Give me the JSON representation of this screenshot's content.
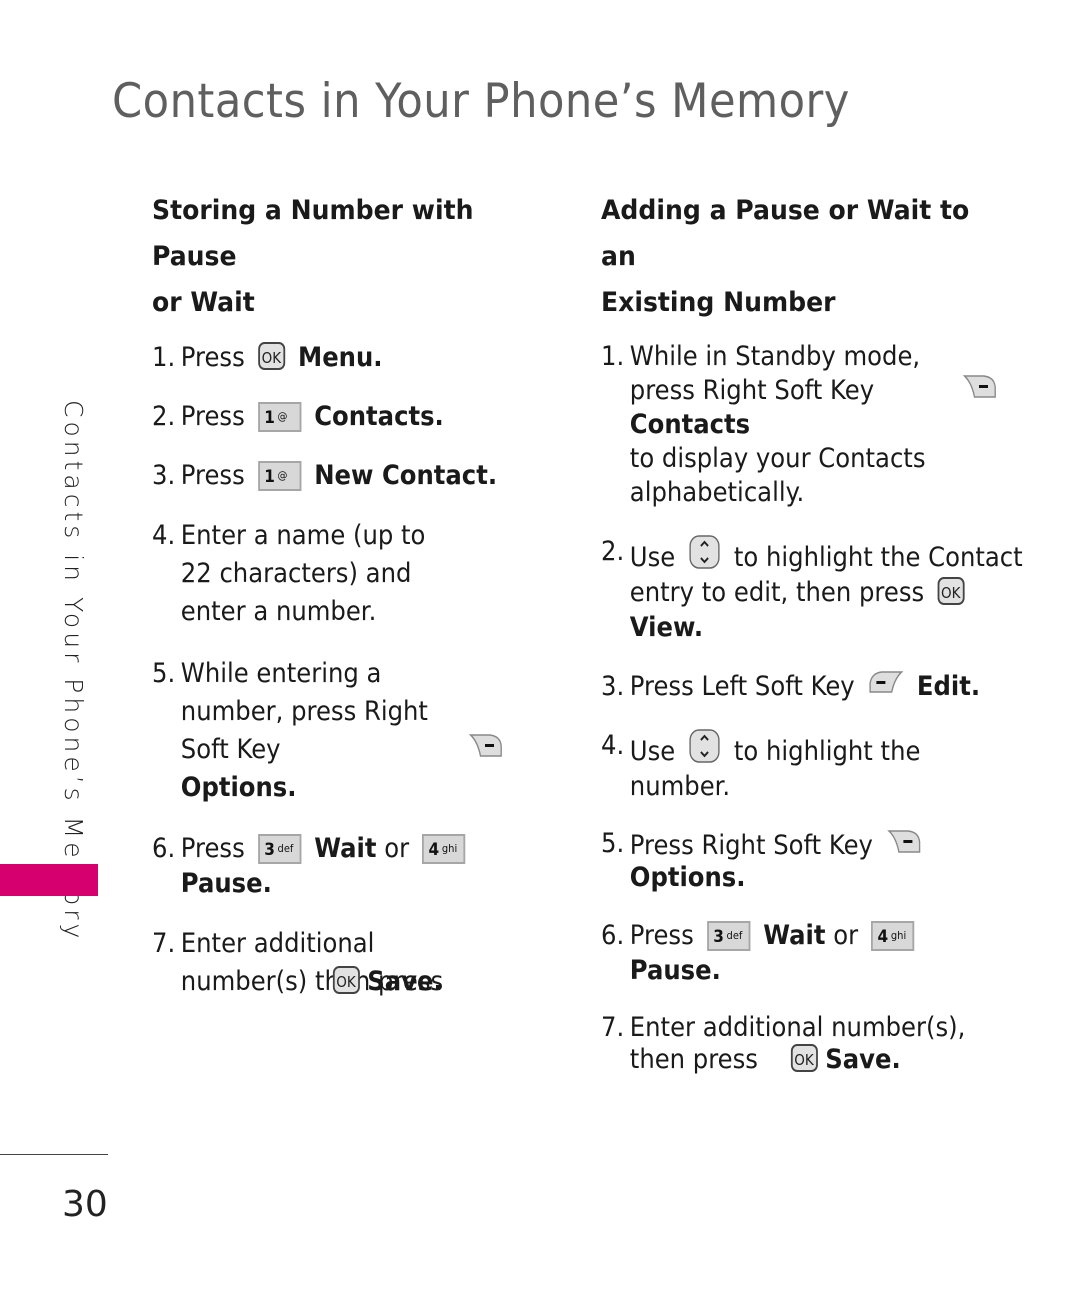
{
  "page": {
    "title": "Contacts in Your Phone’s Memory",
    "side_tab": "Contacts in Your Phone’s Memory",
    "page_number": "30",
    "accent_color": "#d6006f"
  },
  "left_section": {
    "heading_line1": "Storing a Number with Pause",
    "heading_line2": "or Wait",
    "steps": [
      {
        "num": "1.",
        "text": "Press",
        "icon": "ok-key-icon",
        "bold": "Menu."
      },
      {
        "num": "2.",
        "text": "Press",
        "icon": "key-1-icon",
        "bold": "Contacts."
      },
      {
        "num": "3.",
        "text": "Press",
        "icon": "key-1-icon",
        "bold": "New Contact."
      },
      {
        "num": "4.",
        "text": "Enter a name (up to 22 characters) and enter a number."
      },
      {
        "num": "5.",
        "text": "While entering a number, press Right Soft Key",
        "icon": "right-soft-key-icon",
        "bold": "Options."
      },
      {
        "num": "6.",
        "text": "Press",
        "icon": "key-3-icon",
        "bold": "Wait",
        "text2": "or",
        "icon2": "key-4-icon",
        "bold2": "Pause."
      },
      {
        "num": "7.",
        "text": "Enter additional number(s) then press",
        "icon": "ok-key-icon",
        "bold": "Save."
      }
    ]
  },
  "right_section": {
    "heading_line1": "Adding a Pause or Wait to an",
    "heading_line2": "Existing Number",
    "steps": [
      {
        "num": "1.",
        "text": "While in Standby mode, press Right Soft Key",
        "icon": "right-soft-key-icon",
        "bold": "Contacts",
        "text2": "to display your Contacts alphabetically."
      },
      {
        "num": "2.",
        "text": "Use",
        "icon": "nav-key-icon",
        "text2": "to highlight the Contact entry to edit, then press",
        "icon2": "ok-key-icon",
        "bold": "View."
      },
      {
        "num": "3.",
        "text": "Press Left Soft Key",
        "icon": "left-soft-key-icon",
        "bold": "Edit."
      },
      {
        "num": "4.",
        "text": "Use",
        "icon": "nav-key-icon",
        "text2": "to highlight the number."
      },
      {
        "num": "5.",
        "text": "Press Right Soft Key",
        "icon": "right-soft-key-icon",
        "bold": "Options."
      },
      {
        "num": "6.",
        "text": "Press",
        "icon": "key-3-icon",
        "bold": "Wait",
        "text2": "or",
        "icon2": "key-4-icon",
        "bold2": "Pause."
      },
      {
        "num": "7.",
        "text": "Enter additional number(s), then press",
        "icon": "ok-key-icon",
        "bold": "Save."
      }
    ]
  },
  "keys": {
    "ok": "OK",
    "key1_digit": "1",
    "key1_sub": "@",
    "key3_digit": "3",
    "key3_sub": "def",
    "key4_digit": "4",
    "key4_sub": "ghi"
  }
}
